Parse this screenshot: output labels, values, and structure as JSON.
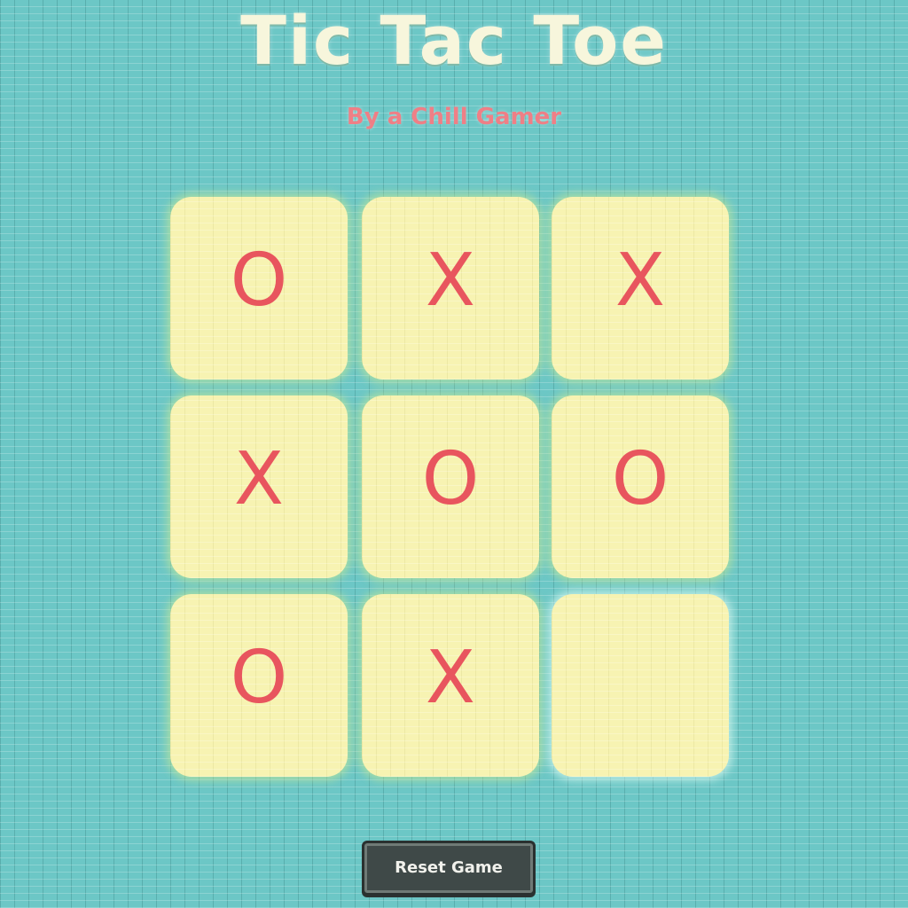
{
  "header": {
    "title": "Tic Tac Toe",
    "subtitle": "By a Chill Gamer"
  },
  "board": {
    "cells": [
      "O",
      "X",
      "X",
      "X",
      "O",
      "O",
      "O",
      "X",
      ""
    ]
  },
  "controls": {
    "reset_label": "Reset Game"
  },
  "colors": {
    "background": "#6cc7c6",
    "cell": "#f7f3b2",
    "mark": "#e8555e",
    "title": "#f7f6dc",
    "subtitle": "#ef7f86",
    "button": "#3f4948"
  }
}
